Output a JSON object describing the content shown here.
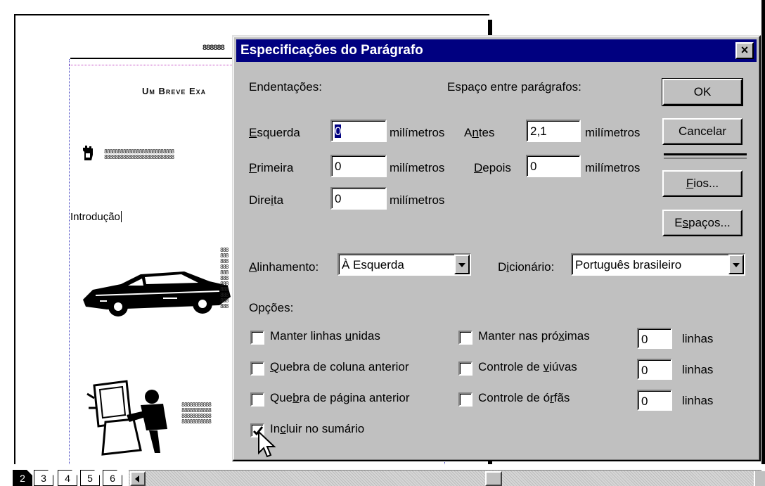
{
  "document": {
    "header_glyphs": "888888",
    "title": "Um Breve Exa",
    "heading_text": "Introdução",
    "filler_a": "88888888888888888888888888\n88888888888888888888888888",
    "filler_b": "888\n888\n888\n888\n888\n888\n888\n888\n888\n888\n888",
    "filler_c": "88888888888\n88888888888\n88888888888\n88888888888"
  },
  "page_tabs": [
    "2",
    "3",
    "4",
    "5",
    "6"
  ],
  "dialog": {
    "title": "Especificações do Parágrafo",
    "close_label": "×",
    "indent_header": "Endentações:",
    "spacing_header": "Espaço entre parágrafos:",
    "left_label_hotkey": "E",
    "left_label_rest": "squerda",
    "left_value": "0",
    "first_label_hotkey": "P",
    "first_label_rest": "rimeira",
    "first_value": "0",
    "right_label_pre": "Dire",
    "right_label_hotkey": "i",
    "right_label_post": "ta",
    "right_value": "0",
    "unit": "milímetros",
    "before_label_pre": "A",
    "before_label_hotkey": "n",
    "before_label_post": "tes",
    "before_value": "2,1",
    "after_label_hotkey": "D",
    "after_label_rest": "epois",
    "after_value": "0",
    "alignment_label_hotkey": "A",
    "alignment_label_rest": "linhamento:",
    "alignment_value": "À Esquerda",
    "dictionary_label_pre": "D",
    "dictionary_label_hotkey": "i",
    "dictionary_label_post": "cionário:",
    "dictionary_value": "Português brasileiro",
    "options_header": "Opções:",
    "buttons": {
      "ok": "OK",
      "cancel": "Cancelar",
      "rules_hotkey": "F",
      "rules_rest": "ios...",
      "spacing_pre": "E",
      "spacing_hotkey": "s",
      "spacing_post": "paços..."
    },
    "options": {
      "keep_lines_pre": "Manter linhas ",
      "keep_lines_hotkey": "u",
      "keep_lines_post": "nidas",
      "col_break_hotkey": "Q",
      "col_break_rest": "uebra de coluna anterior",
      "page_break_pre": "Que",
      "page_break_hotkey": "b",
      "page_break_post": "ra de página anterior",
      "include_toc_pre": "In",
      "include_toc_hotkey": "c",
      "include_toc_post": "luir no sumário",
      "keep_next_pre": "Manter nas pró",
      "keep_next_hotkey": "x",
      "keep_next_post": "imas",
      "widow_pre": "Controle de ",
      "widow_hotkey": "v",
      "widow_post": "iúvas",
      "orphan_pre": "Controle de ó",
      "orphan_hotkey": "r",
      "orphan_post": "fãs",
      "keep_next_value": "0",
      "widow_value": "0",
      "orphan_value": "0",
      "lines_unit": "linhas",
      "include_toc_checked": true
    }
  }
}
